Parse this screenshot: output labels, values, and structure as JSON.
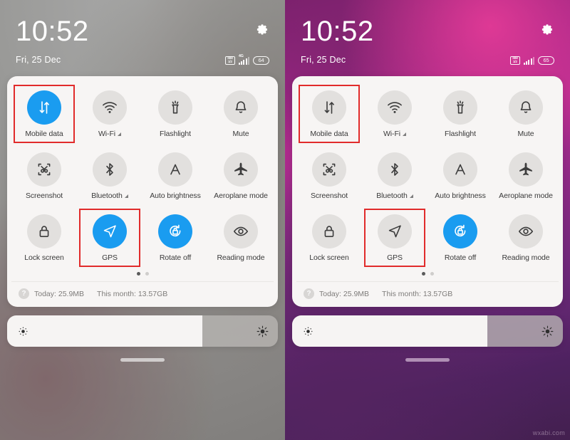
{
  "panels": [
    {
      "id": "left",
      "variant": "reading-mode-on",
      "status": {
        "time": "10:52",
        "date": "Fri, 25 Dec",
        "sim_line1": "SIM",
        "sim_line2": "1/2",
        "network_label": "4G",
        "battery": "64",
        "gear_icon": "gear-icon"
      },
      "tiles": [
        {
          "label": "Mobile data",
          "icon": "data-transfer-icon",
          "on": true,
          "highlight": true,
          "badge": ""
        },
        {
          "label": "Wi-Fi",
          "icon": "wifi-icon",
          "on": false,
          "highlight": false,
          "badge": "triangle"
        },
        {
          "label": "Flashlight",
          "icon": "flashlight-icon",
          "on": false,
          "highlight": false,
          "badge": ""
        },
        {
          "label": "Mute",
          "icon": "bell-icon",
          "on": false,
          "highlight": false,
          "badge": ""
        },
        {
          "label": "Screenshot",
          "icon": "screenshot-icon",
          "on": false,
          "highlight": false,
          "badge": ""
        },
        {
          "label": "Bluetooth",
          "icon": "bluetooth-icon",
          "on": false,
          "highlight": false,
          "badge": "triangle"
        },
        {
          "label": "Auto brightness",
          "icon": "auto-brightness-icon",
          "on": false,
          "highlight": false,
          "badge": ""
        },
        {
          "label": "Aeroplane mode",
          "icon": "airplane-icon",
          "on": false,
          "highlight": false,
          "badge": ""
        },
        {
          "label": "Lock screen",
          "icon": "lock-icon",
          "on": false,
          "highlight": false,
          "badge": ""
        },
        {
          "label": "GPS",
          "icon": "navigation-arrow-icon",
          "on": true,
          "highlight": true,
          "badge": ""
        },
        {
          "label": "Rotate off",
          "icon": "rotate-lock-icon",
          "on": true,
          "highlight": false,
          "badge": ""
        },
        {
          "label": "Reading mode",
          "icon": "eye-icon",
          "on": false,
          "highlight": false,
          "badge": ""
        }
      ],
      "pager": {
        "count": 2,
        "active": 0
      },
      "usage": {
        "help_icon": "question-mark-icon",
        "today": "Today: 25.9MB",
        "month": "This month: 13.57GB"
      },
      "brightness": {
        "percent": 72,
        "low_icon": "brightness-low-icon",
        "high_icon": "brightness-high-icon"
      },
      "home_indicator": "home-gesture-bar"
    },
    {
      "id": "right",
      "variant": "reading-mode-off",
      "status": {
        "time": "10:52",
        "date": "Fri, 25 Dec",
        "sim_line1": "SIM",
        "sim_line2": "1/2",
        "network_label": "",
        "battery": "65",
        "gear_icon": "gear-icon"
      },
      "tiles": [
        {
          "label": "Mobile data",
          "icon": "data-transfer-icon",
          "on": false,
          "highlight": true,
          "badge": ""
        },
        {
          "label": "Wi-Fi",
          "icon": "wifi-icon",
          "on": false,
          "highlight": false,
          "badge": "triangle"
        },
        {
          "label": "Flashlight",
          "icon": "flashlight-icon",
          "on": false,
          "highlight": false,
          "badge": ""
        },
        {
          "label": "Mute",
          "icon": "bell-icon",
          "on": false,
          "highlight": false,
          "badge": ""
        },
        {
          "label": "Screenshot",
          "icon": "screenshot-icon",
          "on": false,
          "highlight": false,
          "badge": ""
        },
        {
          "label": "Bluetooth",
          "icon": "bluetooth-icon",
          "on": false,
          "highlight": false,
          "badge": "triangle"
        },
        {
          "label": "Auto brightness",
          "icon": "auto-brightness-icon",
          "on": false,
          "highlight": false,
          "badge": ""
        },
        {
          "label": "Aeroplane mode",
          "icon": "airplane-icon",
          "on": false,
          "highlight": false,
          "badge": ""
        },
        {
          "label": "Lock screen",
          "icon": "lock-icon",
          "on": false,
          "highlight": false,
          "badge": ""
        },
        {
          "label": "GPS",
          "icon": "navigation-arrow-icon",
          "on": false,
          "highlight": true,
          "badge": ""
        },
        {
          "label": "Rotate off",
          "icon": "rotate-lock-icon",
          "on": true,
          "highlight": false,
          "badge": ""
        },
        {
          "label": "Reading mode",
          "icon": "eye-icon",
          "on": false,
          "highlight": false,
          "badge": ""
        }
      ],
      "pager": {
        "count": 2,
        "active": 0
      },
      "usage": {
        "help_icon": "question-mark-icon",
        "today": "Today: 25.9MB",
        "month": "This month: 13.57GB"
      },
      "brightness": {
        "percent": 72,
        "low_icon": "brightness-low-icon",
        "high_icon": "brightness-high-icon"
      },
      "home_indicator": "home-gesture-bar"
    }
  ],
  "watermark": "wxabi.com",
  "colors": {
    "accent_on": "#1a9cf0",
    "highlight": "#e12b2b",
    "card": "#f7f5f4",
    "puck_off": "#e2e0de"
  }
}
